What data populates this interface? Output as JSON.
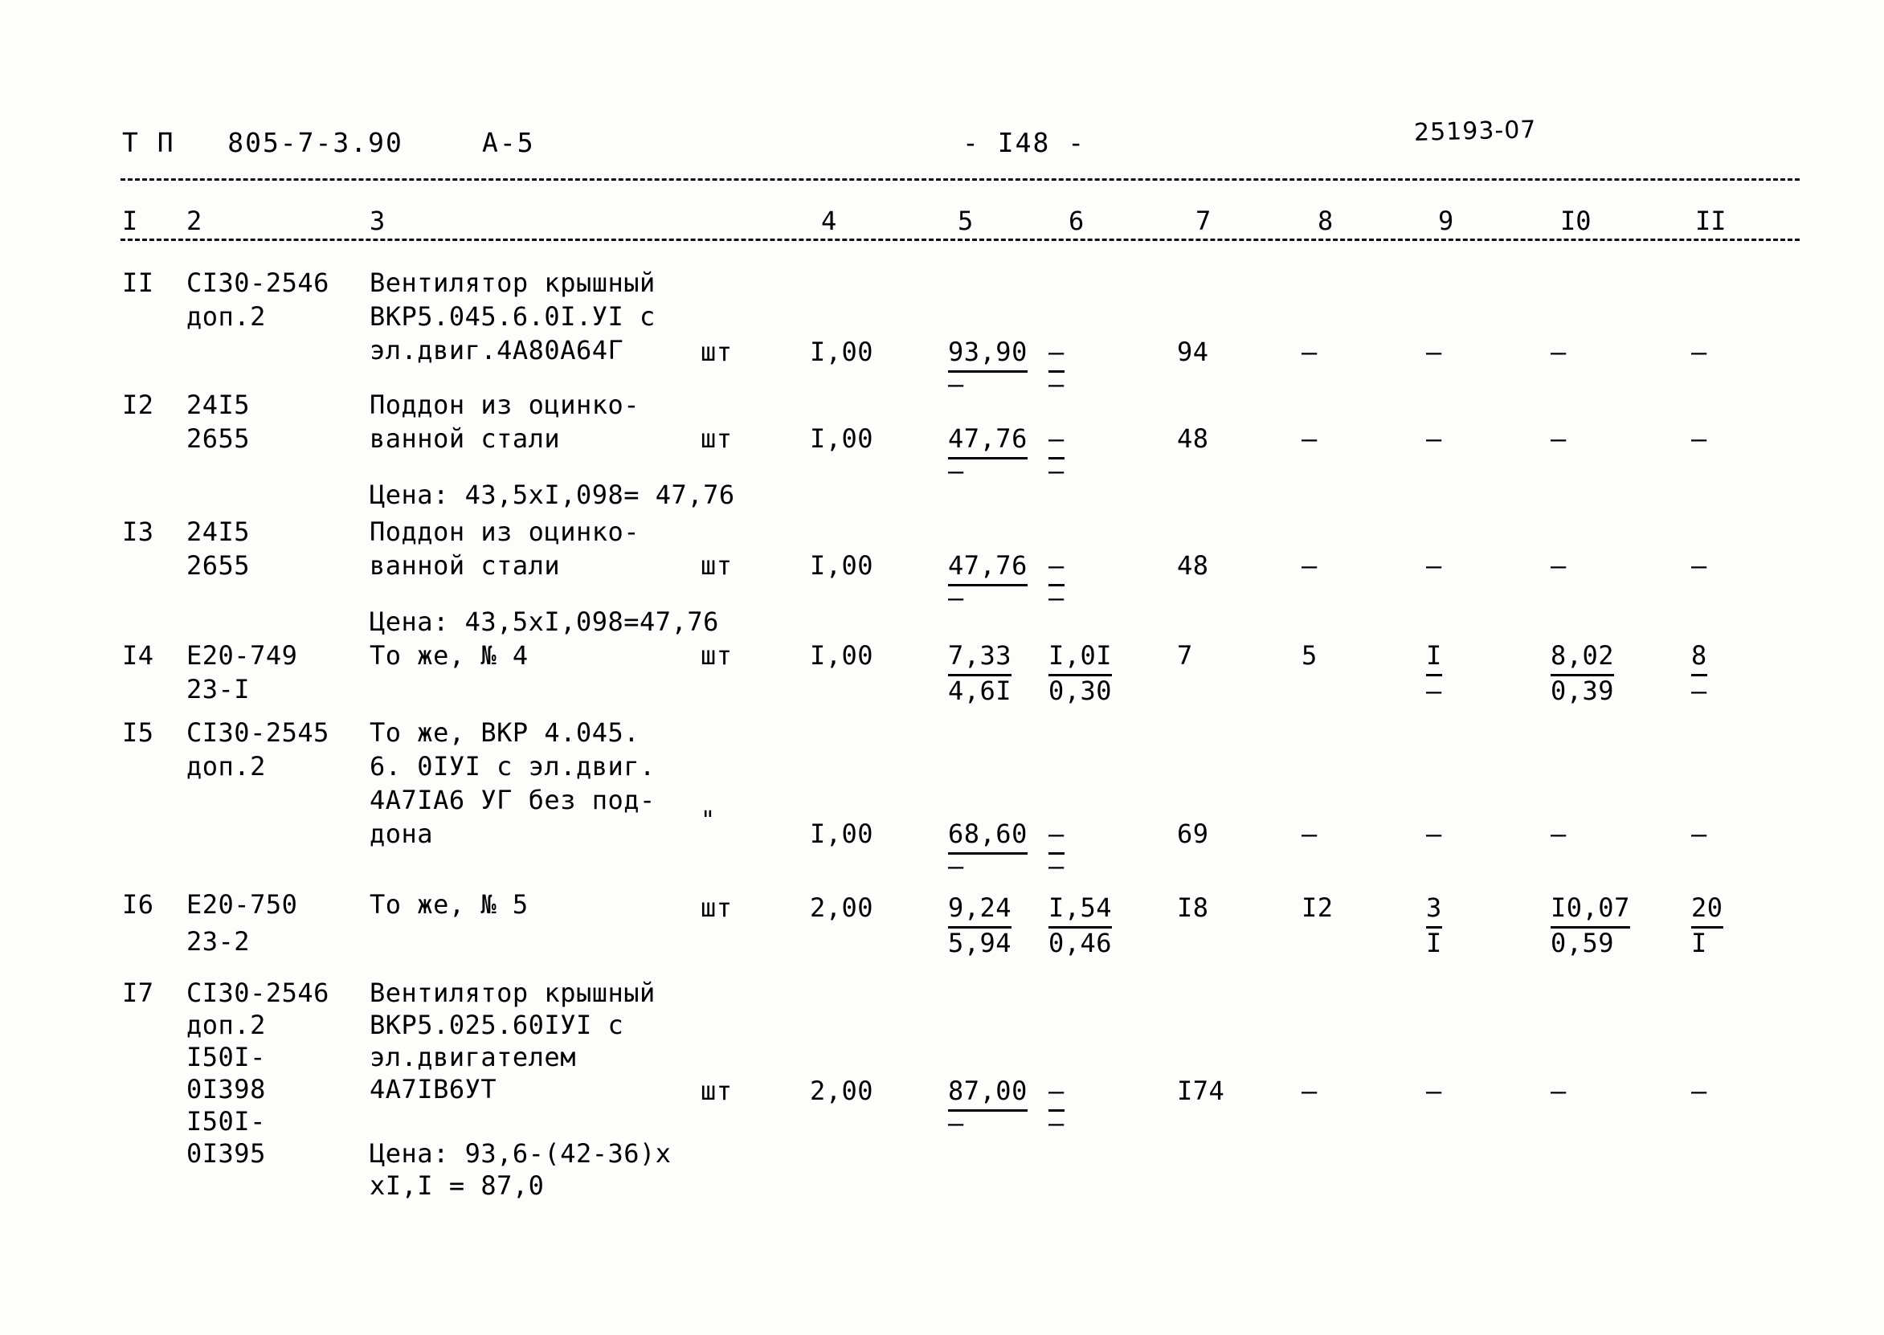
{
  "header": {
    "doc_code": "Т П   805-7-3.90",
    "revision": "А-5",
    "page_marker": "- I48 -",
    "stamp": "25193-07"
  },
  "column_numbers": [
    "I",
    "2",
    "3",
    "4",
    "5",
    "6",
    "7",
    "8",
    "9",
    "I0",
    "II"
  ],
  "rows": [
    {
      "pos": "II",
      "code_lines": [
        "CI30-2546",
        "доп.2"
      ],
      "desc_lines": [
        "Вентилятор крышный",
        "ВКР5.045.6.0I.УI с",
        "эл.двиг.4А80А64Г"
      ],
      "unit": "шт",
      "qty": "I,00",
      "c5_top": "93,90",
      "c5_bot": "–",
      "c6_top": "–",
      "c6_bot": "–",
      "c7": "94",
      "c8": "–",
      "c9": "–",
      "c10": "–",
      "c11": "–",
      "note": ""
    },
    {
      "pos": "I2",
      "code_lines": [
        "24I5",
        "2655"
      ],
      "desc_lines": [
        "Поддон из оцинко-",
        "ванной стали"
      ],
      "unit": "шт",
      "qty": "I,00",
      "c5_top": "47,76",
      "c5_bot": "–",
      "c6_top": "–",
      "c6_bot": "–",
      "c7": "48",
      "c8": "–",
      "c9": "–",
      "c10": "–",
      "c11": "–",
      "note": "Цена: 43,5xI,098= 47,76"
    },
    {
      "pos": "I3",
      "code_lines": [
        "24I5",
        "2655"
      ],
      "desc_lines": [
        "Поддон из оцинко-",
        "ванной стали"
      ],
      "unit": "шт",
      "qty": "I,00",
      "c5_top": "47,76",
      "c5_bot": "–",
      "c6_top": "–",
      "c6_bot": "–",
      "c7": "48",
      "c8": "–",
      "c9": "–",
      "c10": "–",
      "c11": "–",
      "note": "Цена: 43,5xI,098=47,76"
    },
    {
      "pos": "I4",
      "code_lines": [
        "Е20-749",
        "23-I"
      ],
      "desc_lines": [
        "То же, № 4"
      ],
      "unit": "шт",
      "qty": "I,00",
      "c5_top": "7,33",
      "c5_bot": "4,6I",
      "c6_top": "I,0I",
      "c6_bot": "0,30",
      "c7": "7",
      "c8": "5",
      "c9": "I",
      "c9_bot": "–",
      "c10": "8,02",
      "c10_bot": "0,39",
      "c11": "8",
      "c11_bot": "–",
      "note": ""
    },
    {
      "pos": "I5",
      "code_lines": [
        "CI30-2545",
        "доп.2"
      ],
      "desc_lines": [
        "То же, ВКР 4.045.",
        "6. 0IУI с эл.двиг.",
        "4А7IА6 УГ без под-",
        "дона"
      ],
      "unit": "\"",
      "qty": "I,00",
      "c5_top": "68,60",
      "c5_bot": "–",
      "c6_top": "–",
      "c6_bot": "–",
      "c7": "69",
      "c8": "–",
      "c9": "–",
      "c10": "–",
      "c11": "–",
      "note": ""
    },
    {
      "pos": "I6",
      "code_lines": [
        "Е20-750",
        "23-2"
      ],
      "desc_lines": [
        "То же, № 5"
      ],
      "unit": "шт",
      "qty": "2,00",
      "c5_top": "9,24",
      "c5_bot": "5,94",
      "c6_top": "I,54",
      "c6_bot": "0,46",
      "c7": "I8",
      "c8": "I2",
      "c9": "3",
      "c9_bot": "I",
      "c10": "I0,07",
      "c10_bot": "0,59",
      "c11": "20",
      "c11_bot": "I",
      "note": ""
    },
    {
      "pos": "I7",
      "code_lines": [
        "CI30-2546",
        "доп.2",
        "I50I-",
        "0I398",
        "I50I-",
        "0I395"
      ],
      "desc_lines": [
        "Вентилятор крышный",
        "ВКР5.025.60IУI с",
        "эл.двигателем",
        "4А7IВ6УТ"
      ],
      "unit": "шт",
      "qty": "2,00",
      "c5_top": "87,00",
      "c5_bot": "–",
      "c6_top": "–",
      "c6_bot": "–",
      "c7": "I74",
      "c8": "–",
      "c9": "–",
      "c10": "–",
      "c11": "–",
      "note": "Цена: 93,6-(42-36)x",
      "note2": "xI,I = 87,0"
    }
  ]
}
